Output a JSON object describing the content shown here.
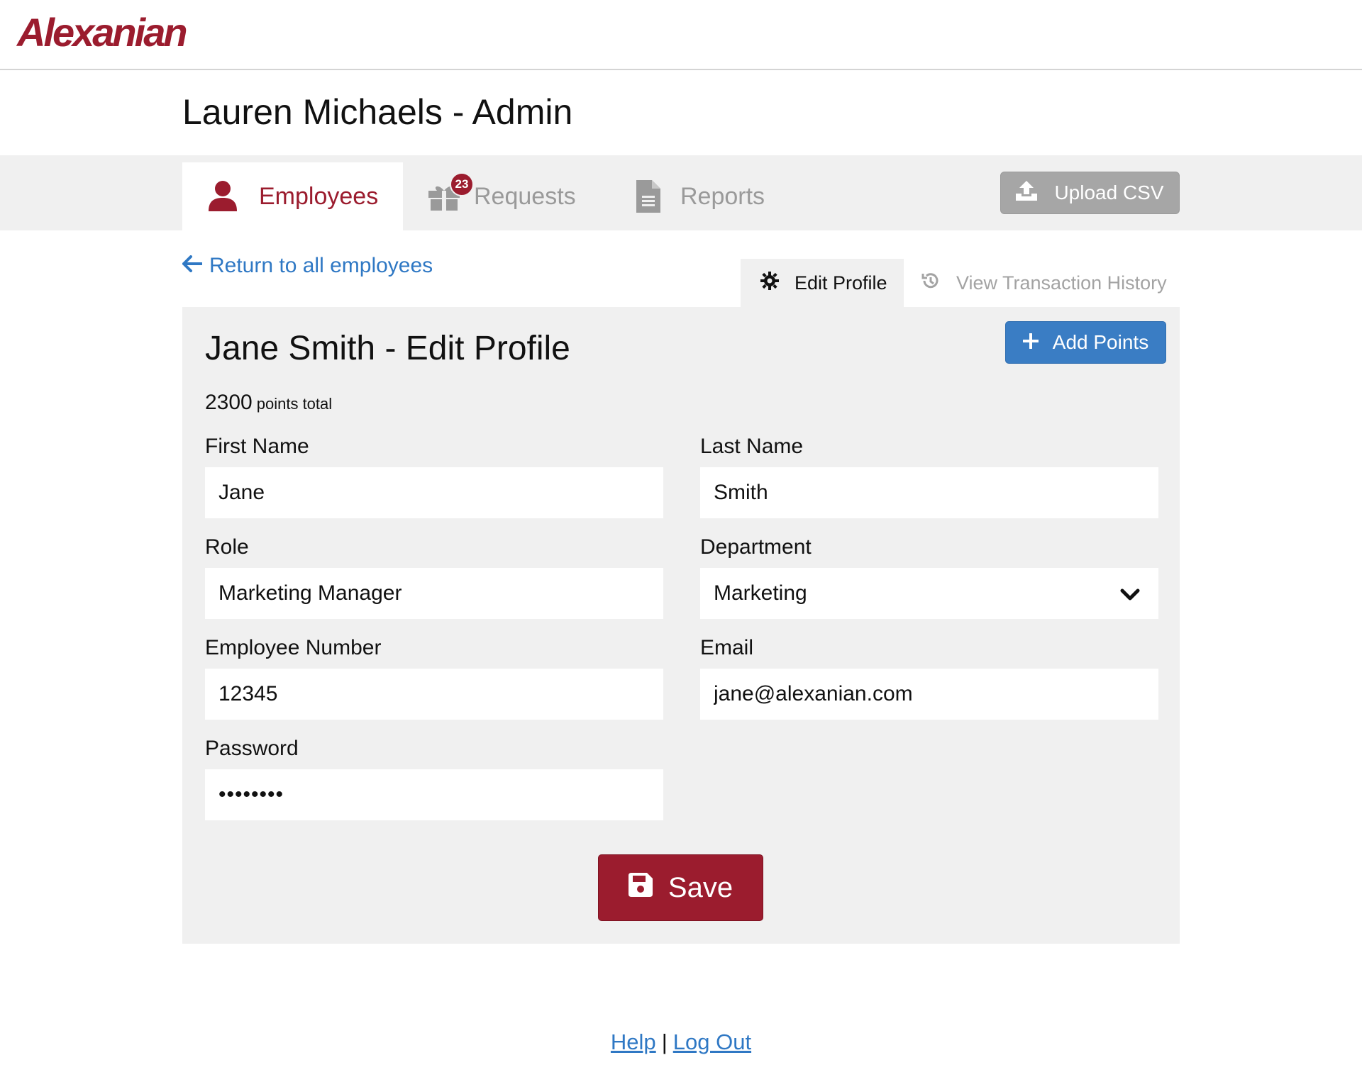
{
  "brand": {
    "logo_text": "Alexanian",
    "accent": "#9b1c2e",
    "link_color": "#2f78c4"
  },
  "header": {
    "page_title": "Lauren Michaels - Admin"
  },
  "nav": {
    "tabs": [
      {
        "label": "Employees",
        "icon": "user-icon",
        "active": true
      },
      {
        "label": "Requests",
        "icon": "gift-icon",
        "badge": "23",
        "active": false
      },
      {
        "label": "Reports",
        "icon": "document-icon",
        "active": false
      }
    ],
    "upload_label": "Upload CSV"
  },
  "return_link": "Return to all employees",
  "subtabs": [
    {
      "label": "Edit Profile",
      "icon": "gear-icon",
      "active": true
    },
    {
      "label": "View Transaction History",
      "icon": "history-icon",
      "active": false
    }
  ],
  "profile": {
    "title": "Jane Smith - Edit Profile",
    "add_points_label": "Add Points",
    "points_value": "2300",
    "points_unit": "points total",
    "fields": {
      "first_name": {
        "label": "First Name",
        "value": "Jane"
      },
      "last_name": {
        "label": "Last Name",
        "value": "Smith"
      },
      "role": {
        "label": "Role",
        "value": "Marketing Manager"
      },
      "department": {
        "label": "Department",
        "value": "Marketing"
      },
      "employee_number": {
        "label": "Employee Number",
        "value": "12345"
      },
      "email": {
        "label": "Email",
        "value": "jane@alexanian.com"
      },
      "password": {
        "label": "Password",
        "value": "••••••••"
      }
    },
    "save_label": "Save"
  },
  "footer": {
    "help": "Help",
    "separator": "|",
    "logout": "Log Out"
  }
}
